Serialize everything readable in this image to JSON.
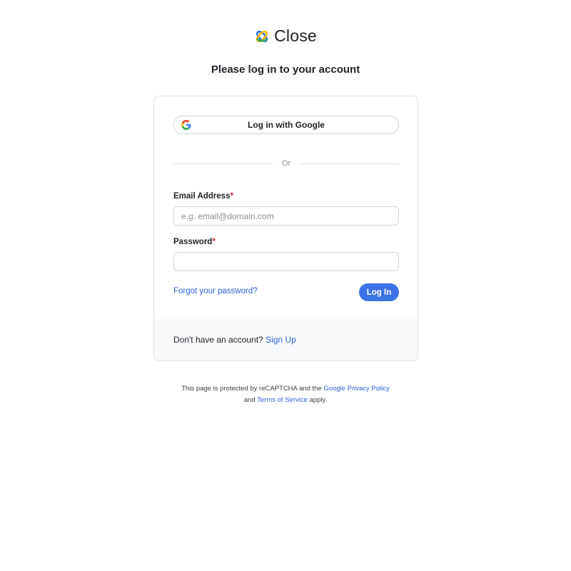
{
  "brand": {
    "name": "Close",
    "logo_icon": "close-logo-icon",
    "logo_colors": [
      "#2f6fe0",
      "#f4b400",
      "#34a853"
    ]
  },
  "title": "Please log in to your account",
  "google_login": {
    "label": "Log in with Google",
    "icon": "google-icon"
  },
  "divider_text": "Or",
  "form": {
    "email": {
      "label": "Email Address",
      "required_mark": "*",
      "placeholder": "e.g. email@domain.com",
      "value": ""
    },
    "password": {
      "label": "Password",
      "required_mark": "*",
      "placeholder": "",
      "value": ""
    },
    "forgot_password": "Forgot your password?",
    "submit_label": "Log In"
  },
  "footer": {
    "prompt": "Don't have an account?",
    "signup_link": "Sign Up"
  },
  "legal": {
    "text_1": "This page is protected by reCAPTCHA and the",
    "privacy_link": "Google Privacy Policy",
    "text_2": "and",
    "terms_link": "Terms of Service",
    "text_3": "apply."
  },
  "colors": {
    "accent": "#3b73e6",
    "link": "#2f62d6",
    "required": "#d1242f",
    "border": "#dde0e4",
    "footer_bg": "#f8f9fa"
  }
}
